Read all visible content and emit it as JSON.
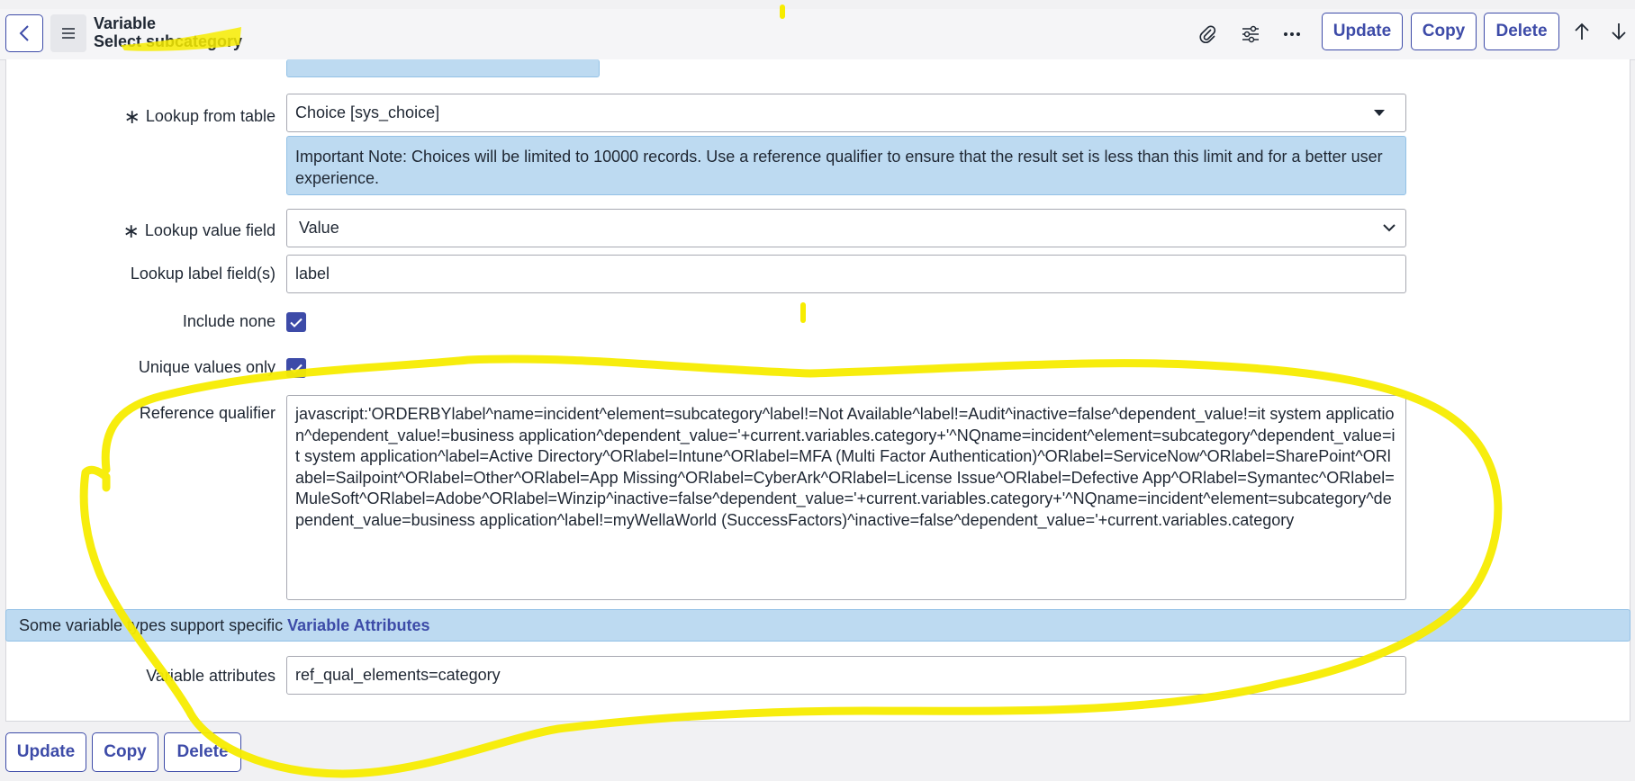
{
  "header": {
    "title": "Variable",
    "subtitle": "Select subcategory",
    "buttons": {
      "update": "Update",
      "copy": "Copy",
      "delete": "Delete"
    },
    "icons": [
      "back-icon",
      "menu-icon",
      "paperclip-icon",
      "sliders-icon",
      "more-icon",
      "arrow-up-icon",
      "arrow-down-icon"
    ]
  },
  "form": {
    "lookup_from_table": {
      "label": "Lookup from table",
      "value": "Choice [sys_choice]",
      "required": true
    },
    "important_note": "Important Note: Choices will be limited to 10000 records. Use a reference qualifier to ensure that the result set is less than this limit and for a better user experience.",
    "lookup_value_field": {
      "label": "Lookup value field",
      "value": "Value",
      "required": true
    },
    "lookup_label_fields": {
      "label": "Lookup label field(s)",
      "value": "label"
    },
    "include_none": {
      "label": "Include none",
      "checked": true
    },
    "unique_values_only": {
      "label": "Unique values only",
      "checked": true
    },
    "reference_qualifier": {
      "label": "Reference qualifier",
      "value": "javascript:'ORDERBYlabel^name=incident^element=subcategory^label!=Not Available^label!=Audit^inactive=false^dependent_value!=it system application^dependent_value!=business application^dependent_value='+current.variables.category+'^NQname=incident^element=subcategory^dependent_value=it system application^label=Active Directory^ORlabel=Intune^ORlabel=MFA (Multi Factor Authentication)^ORlabel=ServiceNow^ORlabel=SharePoint^ORlabel=Sailpoint^ORlabel=Other^ORlabel=App Missing^ORlabel=CyberArk^ORlabel=License Issue^ORlabel=Defective App^ORlabel=Symantec^ORlabel=MuleSoft^ORlabel=Adobe^ORlabel=Winzip^inactive=false^dependent_value='+current.variables.category+'^NQname=incident^element=subcategory^dependent_value=business application^label!=myWellaWorld (SuccessFactors)^inactive=false^dependent_value='+current.variables.category"
    },
    "attributes_banner": {
      "text": "Some variable types support specific ",
      "link": "Variable Attributes"
    },
    "variable_attributes": {
      "label": "Variable attributes",
      "value": "ref_qual_elements=category"
    }
  },
  "footer": {
    "buttons": {
      "update": "Update",
      "copy": "Copy",
      "delete": "Delete"
    }
  },
  "colors": {
    "accent": "#3d4ba8",
    "info_bg": "#bddaf1",
    "highlight": "#f7ec00"
  }
}
